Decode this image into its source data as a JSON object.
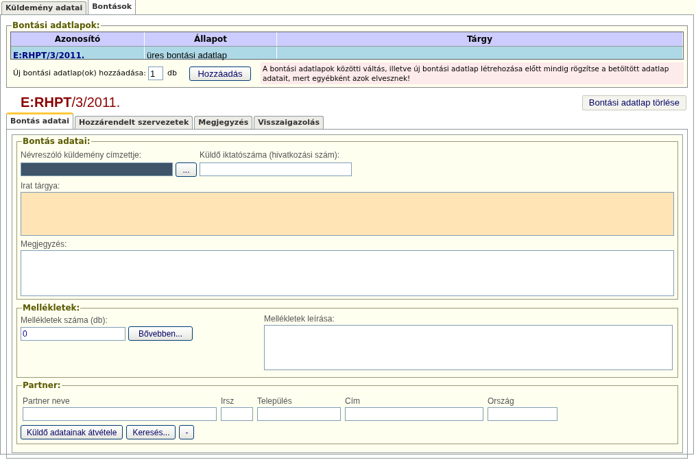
{
  "tabs": [
    {
      "label": "Küldemény adatai",
      "selected": false
    },
    {
      "label": "Bontások",
      "selected": true
    }
  ],
  "sheets": {
    "legend": "Bontási adatlapok:",
    "columns": [
      "Azonosító",
      "Állapot",
      "Tárgy"
    ],
    "rows": [
      {
        "cells": [
          "E:RHPT/3/2011.",
          "üres bontási adatlap",
          ""
        ],
        "selected": true
      }
    ],
    "add_label": "Új bontási adatlap(ok) hozzáadása:",
    "add_count": "1",
    "add_unit": "db",
    "add_button": "Hozzáadás",
    "warning": "A bontási adatlapok közötti váltás, illetve új bontási adatlap létrehozása előtt mindig rögzítse a betöltött adatlap adatait, mert egyébként azok elvesznek!"
  },
  "record_title": "**E:RHPT**/3/2011.",
  "delete_button": "Bontási adatlap törlése",
  "subtabs": [
    {
      "label": "Bontás adatai",
      "selected": true
    },
    {
      "label": "Hozzárendelt szervezetek",
      "selected": false
    },
    {
      "label": "Megjegyzés",
      "selected": false
    },
    {
      "label": "Visszaigazolás",
      "selected": false
    }
  ],
  "opening": {
    "legend": "Bontás adatai:",
    "recipient": {
      "label": "Névreszóló küldemény címzettje:",
      "disabled": true,
      "button": "..."
    },
    "sender_ref": {
      "label": "Küldő iktatószáma (hivatkozási szám):",
      "required": false
    },
    "subject": {
      "label": "Irat tárgya:",
      "required": true
    },
    "note": {
      "label": "Megjegyzés:",
      "required": false
    }
  },
  "attachments": {
    "legend": "Mellékletek:",
    "count_label": "Mellékletek száma (db):",
    "count_value": "0",
    "more_button": "Bővebben...",
    "desc_label": "Mellékletek leírása:"
  },
  "partner": {
    "legend": "Partner:",
    "fields": [
      {
        "label": "Partner neve"
      },
      {
        "label": "Irsz"
      },
      {
        "label": "Település"
      },
      {
        "label": "Cím"
      },
      {
        "label": "Ország"
      }
    ],
    "buttons": [
      "Küldő adatainak átvétele",
      "Keresés...",
      "-"
    ]
  }
}
